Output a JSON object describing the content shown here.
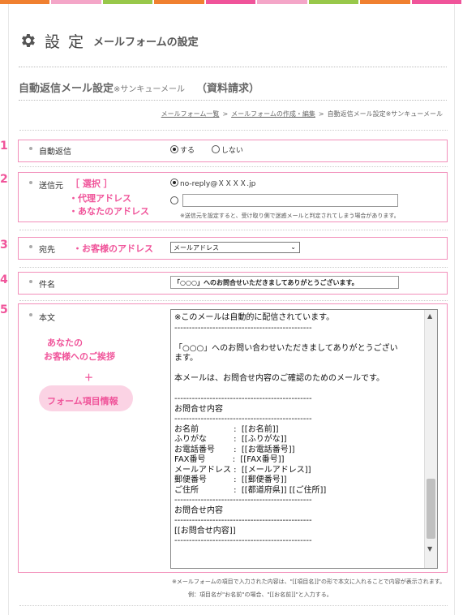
{
  "colorbar": [
    "#f08030",
    "#f4a6c8",
    "#98c84a",
    "#f08030",
    "#f0549a",
    "#f4a6c8",
    "#98c84a",
    "#f08030",
    "#f0549a"
  ],
  "header": {
    "title": "設 定",
    "subtitle": "メールフォームの設定"
  },
  "section": {
    "title": "自動返信メール設定",
    "title_small": "※サンキューメール",
    "title_paren": "（資料請求）"
  },
  "breadcrumb": {
    "item1": "メールフォーム一覧",
    "sep": ">",
    "item2": "メールフォームの作成・編集",
    "current": "自動返信メール設定※サンキューメール"
  },
  "rows": {
    "n1": "1",
    "n2": "2",
    "n3": "3",
    "n4": "4",
    "n5": "5",
    "auto_reply": {
      "label": "自動返信",
      "opt_yes": "する",
      "opt_no": "しない"
    },
    "sender": {
      "label": "送信元",
      "annot1": "［ 選択 ］",
      "annot2": "・代理アドレス",
      "annot3": "・あなたのアドレス",
      "option1": "no-reply@ＸＸＸＸ.jp",
      "option2_value": "",
      "note": "※送信元を設定すると、受け取り側で迷惑メールと判定されてしまう場合があります。"
    },
    "recipient": {
      "label": "宛先",
      "annot": "・お客様のアドレス",
      "selected": "メールアドレス"
    },
    "subject": {
      "label": "件名",
      "value": "「○○○」へのお問合せいただきましてありがとうございます。"
    },
    "body": {
      "label": "本文",
      "annot1": "あなたの",
      "annot2": "お客様へのご挨拶",
      "annot3": "＋",
      "annot4": "フォーム項目情報",
      "text": "※このメールは自動的に配信されています。\n-----------------------------------------------\n\n「○○○」へのお問い合わせいただきましてありがとうござい\nます。\n\n本メールは、お問合せ内容のご確認のためのメールです。\n\n-----------------------------------------------\nお問合せ内容\n-----------------------------------------------\nお名前　　　　 :  [[お名前]]\nふりがな　　　 :  [[ふりがな]]\nお電話番号　　 :  [[お電話番号]]\nFAX番号　　　 :  [[FAX番号]]\nメールアドレス :  [[メールアドレス]]\n郵便番号　　　 :  [[郵便番号]]\nご住所　　　　 :  [[都道府県]] [[ご住所]]\n-----------------------------------------------\nお問合せ内容\n-----------------------------------------------\n[[お問合せ内容]]\n-----------------------------------------------",
      "note1": "※メールフォームの項目で入力された内容は、\"[[項目名]]\"の形で本文に入れることで内容が表示されます。",
      "note2": "例：項目名が\"お名前\"の場合、\"[[お名前]]\"と入力する。"
    }
  }
}
